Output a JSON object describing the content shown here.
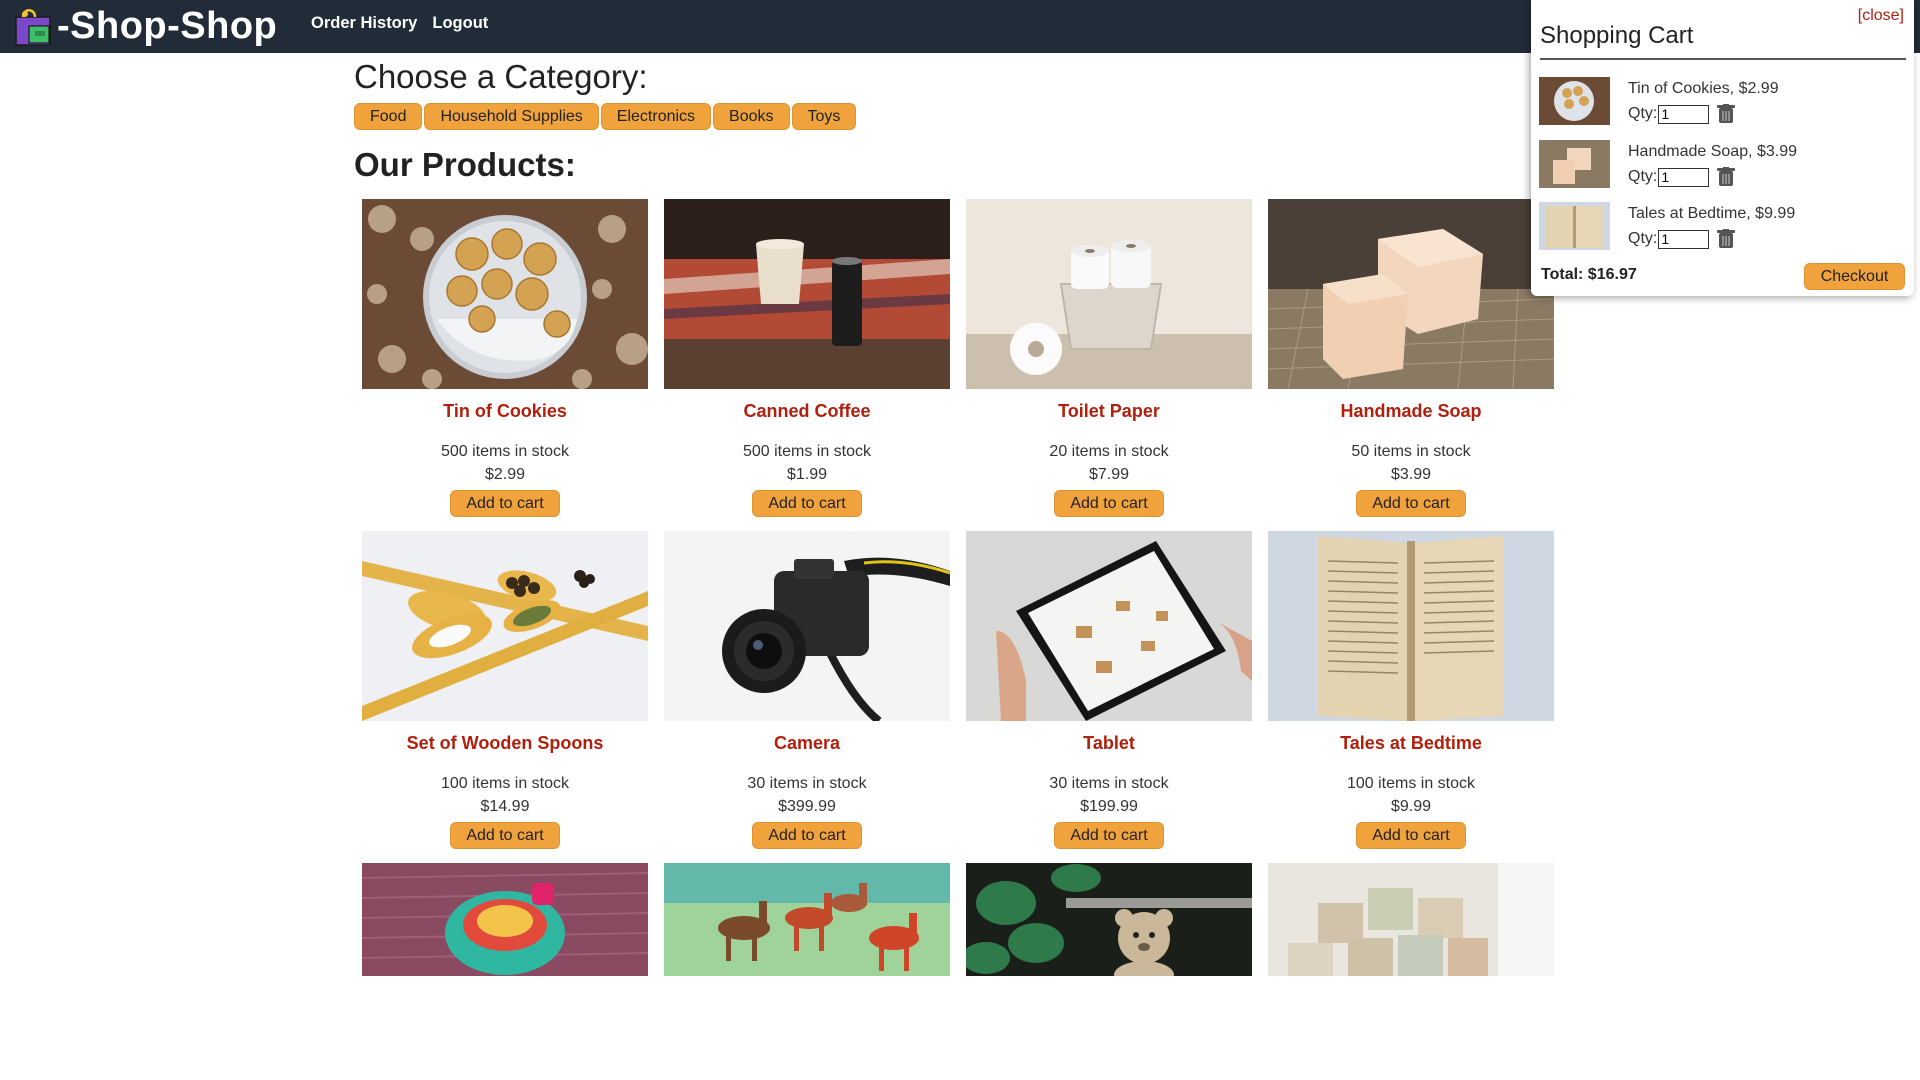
{
  "header": {
    "brand": "-Shop-Shop",
    "brand_icon": "shopping-bag-icon",
    "nav": [
      "Order History",
      "Logout"
    ]
  },
  "categories": {
    "heading": "Choose a Category:",
    "items": [
      "Food",
      "Household Supplies",
      "Electronics",
      "Books",
      "Toys"
    ]
  },
  "products": {
    "heading": "Our Products:",
    "add_label": "Add to cart",
    "items": [
      {
        "name": "Tin of Cookies",
        "stock": "500 items in stock",
        "price": "$2.99",
        "image": "cookies"
      },
      {
        "name": "Canned Coffee",
        "stock": "500 items in stock",
        "price": "$1.99",
        "image": "coffee"
      },
      {
        "name": "Toilet Paper",
        "stock": "20 items in stock",
        "price": "$7.99",
        "image": "toilet-paper"
      },
      {
        "name": "Handmade Soap",
        "stock": "50 items in stock",
        "price": "$3.99",
        "image": "soap"
      },
      {
        "name": "Set of Wooden Spoons",
        "stock": "100 items in stock",
        "price": "$14.99",
        "image": "spoons"
      },
      {
        "name": "Camera",
        "stock": "30 items in stock",
        "price": "$399.99",
        "image": "camera"
      },
      {
        "name": "Tablet",
        "stock": "30 items in stock",
        "price": "$199.99",
        "image": "tablet"
      },
      {
        "name": "Tales at Bedtime",
        "stock": "100 items in stock",
        "price": "$9.99",
        "image": "book"
      },
      {
        "name": "",
        "stock": "",
        "price": "",
        "image": "spinning-top"
      },
      {
        "name": "",
        "stock": "",
        "price": "",
        "image": "toy-horses"
      },
      {
        "name": "",
        "stock": "",
        "price": "",
        "image": "teddy-bear"
      },
      {
        "name": "",
        "stock": "",
        "price": "",
        "image": "alphabet-blocks"
      }
    ]
  },
  "cart": {
    "close_label": "[close]",
    "title": "Shopping Cart",
    "qty_label": "Qty:",
    "items": [
      {
        "label": "Tin of Cookies, $2.99",
        "qty": "1",
        "image": "cookies"
      },
      {
        "label": "Handmade Soap, $3.99",
        "qty": "1",
        "image": "soap"
      },
      {
        "label": "Tales at Bedtime, $9.99",
        "qty": "1",
        "image": "book"
      }
    ],
    "total": "Total: $16.97",
    "checkout_label": "Checkout"
  },
  "colors": {
    "header_bg": "#222b38",
    "accent": "#f0a23c",
    "product_name": "#b21f0c"
  }
}
